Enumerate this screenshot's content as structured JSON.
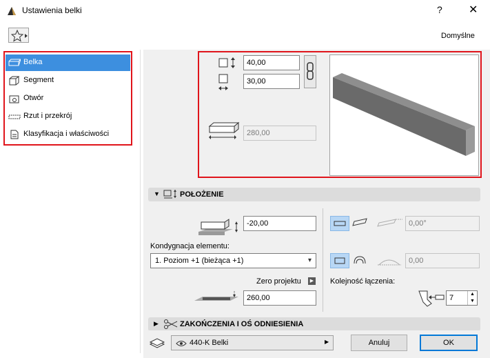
{
  "window": {
    "title": "Ustawienia belki",
    "help": "?",
    "close": "✕"
  },
  "header": {
    "default_label": "Domyślne"
  },
  "sidebar": {
    "items": [
      {
        "label": "Belka",
        "icon": "beam-icon",
        "selected": true
      },
      {
        "label": "Segment",
        "icon": "segment-icon",
        "selected": false
      },
      {
        "label": "Otwór",
        "icon": "opening-icon",
        "selected": false
      },
      {
        "label": "Rzut i przekrój",
        "icon": "floor-plan-section-icon",
        "selected": false
      },
      {
        "label": "Klasyfikacja i właściwości",
        "icon": "classification-icon",
        "selected": false
      }
    ]
  },
  "preview": {
    "width_value": "40,00",
    "height_value": "30,00",
    "length_value": "280,00"
  },
  "position_section": {
    "title": "POŁOŻENIE",
    "offset_value": "-20,00",
    "story_label": "Kondygnacja elementu:",
    "story_value": "1. Poziom +1 (bieżąca +1)",
    "zero_label": "Zero projektu",
    "elevation_value": "260,00",
    "tilt_value": "0,00°",
    "curve_value": "0,00",
    "order_label": "Kolejność łączenia:",
    "order_value": "7"
  },
  "ends_section": {
    "title": "ZAKOŃCZENIA I OŚ ODNIESIENIA"
  },
  "footer": {
    "profile_value": "440-K Belki",
    "cancel_label": "Anuluj",
    "ok_label": "OK"
  },
  "colors": {
    "accent": "#3d8fdf",
    "highlight_box": "#e0131a",
    "default_button_border": "#0078d7"
  }
}
